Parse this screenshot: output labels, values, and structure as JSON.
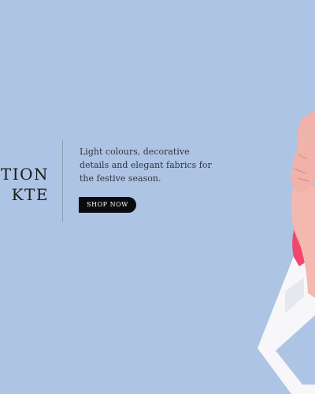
{
  "hero": {
    "title_line1": "TION",
    "title_line2": "KTE",
    "tagline": "Light colours, decorative details and elegant fabrics for the festive season.",
    "cta_label": "SHOP NOW"
  },
  "colors": {
    "background": "#aec4e4",
    "button": "#0b0b0e",
    "button_text": "#ffffff",
    "dress": "#f0476a",
    "skin": "#f3b6ad"
  },
  "image": {
    "subject": "model-seated-on-white-stand"
  }
}
